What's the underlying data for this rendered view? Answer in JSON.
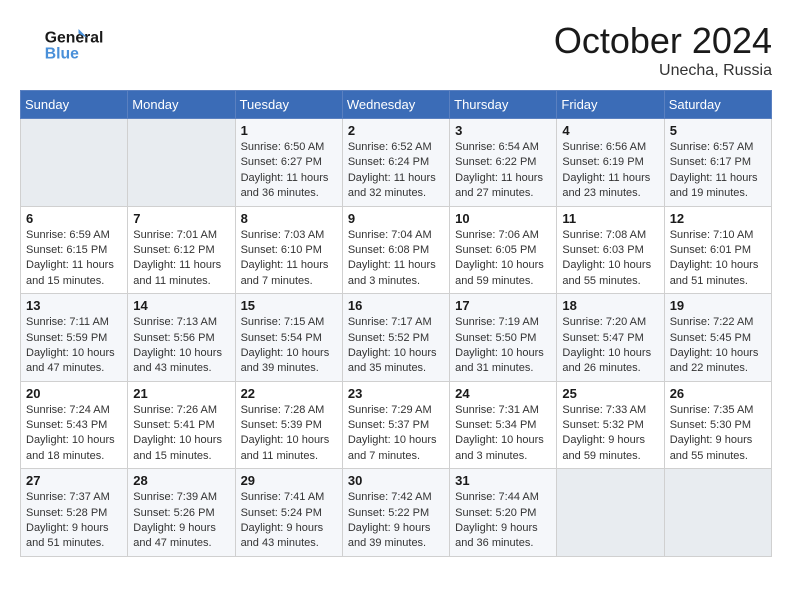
{
  "header": {
    "logo_line1": "General",
    "logo_line2": "Blue",
    "month": "October 2024",
    "location": "Unecha, Russia"
  },
  "weekdays": [
    "Sunday",
    "Monday",
    "Tuesday",
    "Wednesday",
    "Thursday",
    "Friday",
    "Saturday"
  ],
  "weeks": [
    [
      {
        "day": "",
        "info": ""
      },
      {
        "day": "",
        "info": ""
      },
      {
        "day": "1",
        "info": "Sunrise: 6:50 AM\nSunset: 6:27 PM\nDaylight: 11 hours and 36 minutes."
      },
      {
        "day": "2",
        "info": "Sunrise: 6:52 AM\nSunset: 6:24 PM\nDaylight: 11 hours and 32 minutes."
      },
      {
        "day": "3",
        "info": "Sunrise: 6:54 AM\nSunset: 6:22 PM\nDaylight: 11 hours and 27 minutes."
      },
      {
        "day": "4",
        "info": "Sunrise: 6:56 AM\nSunset: 6:19 PM\nDaylight: 11 hours and 23 minutes."
      },
      {
        "day": "5",
        "info": "Sunrise: 6:57 AM\nSunset: 6:17 PM\nDaylight: 11 hours and 19 minutes."
      }
    ],
    [
      {
        "day": "6",
        "info": "Sunrise: 6:59 AM\nSunset: 6:15 PM\nDaylight: 11 hours and 15 minutes."
      },
      {
        "day": "7",
        "info": "Sunrise: 7:01 AM\nSunset: 6:12 PM\nDaylight: 11 hours and 11 minutes."
      },
      {
        "day": "8",
        "info": "Sunrise: 7:03 AM\nSunset: 6:10 PM\nDaylight: 11 hours and 7 minutes."
      },
      {
        "day": "9",
        "info": "Sunrise: 7:04 AM\nSunset: 6:08 PM\nDaylight: 11 hours and 3 minutes."
      },
      {
        "day": "10",
        "info": "Sunrise: 7:06 AM\nSunset: 6:05 PM\nDaylight: 10 hours and 59 minutes."
      },
      {
        "day": "11",
        "info": "Sunrise: 7:08 AM\nSunset: 6:03 PM\nDaylight: 10 hours and 55 minutes."
      },
      {
        "day": "12",
        "info": "Sunrise: 7:10 AM\nSunset: 6:01 PM\nDaylight: 10 hours and 51 minutes."
      }
    ],
    [
      {
        "day": "13",
        "info": "Sunrise: 7:11 AM\nSunset: 5:59 PM\nDaylight: 10 hours and 47 minutes."
      },
      {
        "day": "14",
        "info": "Sunrise: 7:13 AM\nSunset: 5:56 PM\nDaylight: 10 hours and 43 minutes."
      },
      {
        "day": "15",
        "info": "Sunrise: 7:15 AM\nSunset: 5:54 PM\nDaylight: 10 hours and 39 minutes."
      },
      {
        "day": "16",
        "info": "Sunrise: 7:17 AM\nSunset: 5:52 PM\nDaylight: 10 hours and 35 minutes."
      },
      {
        "day": "17",
        "info": "Sunrise: 7:19 AM\nSunset: 5:50 PM\nDaylight: 10 hours and 31 minutes."
      },
      {
        "day": "18",
        "info": "Sunrise: 7:20 AM\nSunset: 5:47 PM\nDaylight: 10 hours and 26 minutes."
      },
      {
        "day": "19",
        "info": "Sunrise: 7:22 AM\nSunset: 5:45 PM\nDaylight: 10 hours and 22 minutes."
      }
    ],
    [
      {
        "day": "20",
        "info": "Sunrise: 7:24 AM\nSunset: 5:43 PM\nDaylight: 10 hours and 18 minutes."
      },
      {
        "day": "21",
        "info": "Sunrise: 7:26 AM\nSunset: 5:41 PM\nDaylight: 10 hours and 15 minutes."
      },
      {
        "day": "22",
        "info": "Sunrise: 7:28 AM\nSunset: 5:39 PM\nDaylight: 10 hours and 11 minutes."
      },
      {
        "day": "23",
        "info": "Sunrise: 7:29 AM\nSunset: 5:37 PM\nDaylight: 10 hours and 7 minutes."
      },
      {
        "day": "24",
        "info": "Sunrise: 7:31 AM\nSunset: 5:34 PM\nDaylight: 10 hours and 3 minutes."
      },
      {
        "day": "25",
        "info": "Sunrise: 7:33 AM\nSunset: 5:32 PM\nDaylight: 9 hours and 59 minutes."
      },
      {
        "day": "26",
        "info": "Sunrise: 7:35 AM\nSunset: 5:30 PM\nDaylight: 9 hours and 55 minutes."
      }
    ],
    [
      {
        "day": "27",
        "info": "Sunrise: 7:37 AM\nSunset: 5:28 PM\nDaylight: 9 hours and 51 minutes."
      },
      {
        "day": "28",
        "info": "Sunrise: 7:39 AM\nSunset: 5:26 PM\nDaylight: 9 hours and 47 minutes."
      },
      {
        "day": "29",
        "info": "Sunrise: 7:41 AM\nSunset: 5:24 PM\nDaylight: 9 hours and 43 minutes."
      },
      {
        "day": "30",
        "info": "Sunrise: 7:42 AM\nSunset: 5:22 PM\nDaylight: 9 hours and 39 minutes."
      },
      {
        "day": "31",
        "info": "Sunrise: 7:44 AM\nSunset: 5:20 PM\nDaylight: 9 hours and 36 minutes."
      },
      {
        "day": "",
        "info": ""
      },
      {
        "day": "",
        "info": ""
      }
    ]
  ]
}
